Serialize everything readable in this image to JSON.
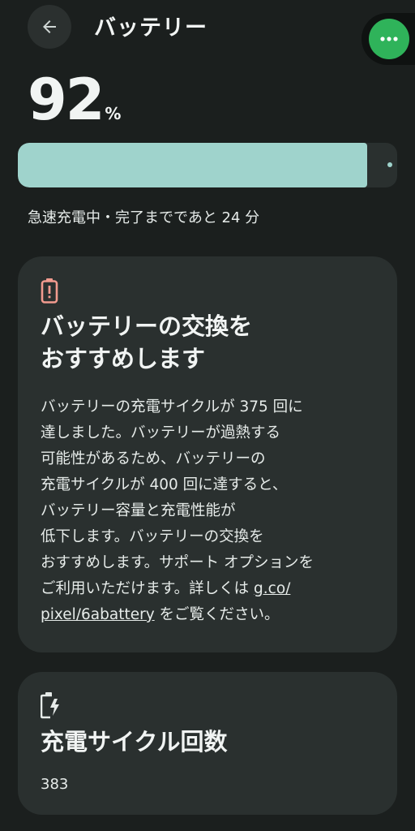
{
  "header": {
    "title": "バッテリー",
    "back_icon": "arrow-left-icon",
    "assistant_icon": "more-dots-icon",
    "assistant_color": "#2fb35a"
  },
  "battery": {
    "level_value": "92",
    "level_unit": "%",
    "level_fraction": 0.92,
    "bar_color": "#9fd3cc",
    "status": "急速充電中・完了までであと 24 分"
  },
  "replace_card": {
    "icon": "battery-alert-icon",
    "icon_color": "#f29b8f",
    "title_line1": "バッテリーの交換を",
    "title_line2": "おすすめします",
    "body_line1": "バッテリーの充電サイクルが 375 回に",
    "body_line2": "達しました。バッテリーが過熱する",
    "body_line3": "可能性があるため、バッテリーの",
    "body_line4": "充電サイクルが 400 回に達すると、",
    "body_line5": "バッテリー容量と充電性能が",
    "body_line6": "低下します。バッテリーの交換を",
    "body_line7": "おすすめします。サポート オプションを",
    "body_line8_prefix": "ご利用いただけます。詳しくは ",
    "body_line8_link": "g.co/",
    "body_line9_link": "pixel/6abattery",
    "body_line9_suffix": " をご覧ください。"
  },
  "cycle_card": {
    "icon": "battery-charging-icon",
    "title": "充電サイクル回数",
    "value": "383"
  }
}
